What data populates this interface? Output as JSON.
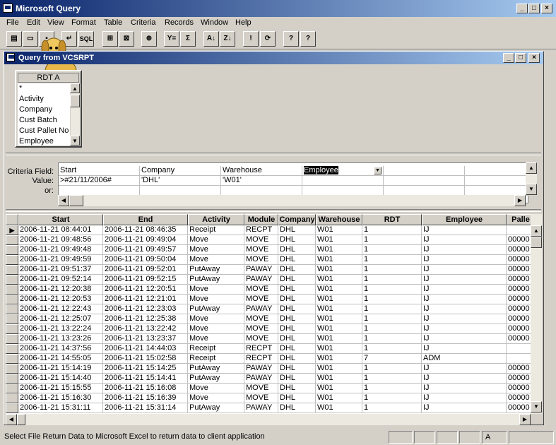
{
  "app": {
    "title": "Microsoft Query"
  },
  "menu": [
    "File",
    "Edit",
    "View",
    "Format",
    "Table",
    "Criteria",
    "Records",
    "Window",
    "Help"
  ],
  "toolbar": {
    "sql_label": "SQL",
    "sum_label": "Σ",
    "exclaim_label": "!"
  },
  "query_window": {
    "title": "Query from VCSRPT"
  },
  "table_box": {
    "name": "RDT A",
    "fields": [
      "*",
      "Activity",
      "Company",
      "Cust Batch",
      "Cust Pallet No",
      "Employee"
    ]
  },
  "criteria": {
    "labels": [
      "Criteria Field:",
      "Value:",
      "or:"
    ],
    "fields": [
      "Start",
      "Company",
      "Warehouse",
      "Employee",
      "",
      ""
    ],
    "values": [
      ">#21/11/2006#",
      "'DHL'",
      "'W01'",
      "",
      "",
      ""
    ]
  },
  "data_grid": {
    "columns": [
      "Start",
      "End",
      "Activity",
      "Module",
      "Company",
      "Warehouse",
      "RDT",
      "Employee",
      "Palle"
    ],
    "rows": [
      [
        "2006-11-21 08:44:01",
        "2006-11-21 08:46:35",
        "Receipt",
        "RECPT",
        "DHL",
        "W01",
        "1",
        "IJ",
        ""
      ],
      [
        "2006-11-21 09:48:56",
        "2006-11-21 09:49:04",
        "Move",
        "MOVE",
        "DHL",
        "W01",
        "1",
        "IJ",
        "00000"
      ],
      [
        "2006-11-21 09:49:48",
        "2006-11-21 09:49:57",
        "Move",
        "MOVE",
        "DHL",
        "W01",
        "1",
        "IJ",
        "00000"
      ],
      [
        "2006-11-21 09:49:59",
        "2006-11-21 09:50:04",
        "Move",
        "MOVE",
        "DHL",
        "W01",
        "1",
        "IJ",
        "00000"
      ],
      [
        "2006-11-21 09:51:37",
        "2006-11-21 09:52:01",
        "PutAway",
        "PAWAY",
        "DHL",
        "W01",
        "1",
        "IJ",
        "00000"
      ],
      [
        "2006-11-21 09:52:14",
        "2006-11-21 09:52:15",
        "PutAway",
        "PAWAY",
        "DHL",
        "W01",
        "1",
        "IJ",
        "00000"
      ],
      [
        "2006-11-21 12:20:38",
        "2006-11-21 12:20:51",
        "Move",
        "MOVE",
        "DHL",
        "W01",
        "1",
        "IJ",
        "00000"
      ],
      [
        "2006-11-21 12:20:53",
        "2006-11-21 12:21:01",
        "Move",
        "MOVE",
        "DHL",
        "W01",
        "1",
        "IJ",
        "00000"
      ],
      [
        "2006-11-21 12:22:43",
        "2006-11-21 12:23:03",
        "PutAway",
        "PAWAY",
        "DHL",
        "W01",
        "1",
        "IJ",
        "00000"
      ],
      [
        "2006-11-21 12:25:07",
        "2006-11-21 12:25:38",
        "Move",
        "MOVE",
        "DHL",
        "W01",
        "1",
        "IJ",
        "00000"
      ],
      [
        "2006-11-21 13:22:24",
        "2006-11-21 13:22:42",
        "Move",
        "MOVE",
        "DHL",
        "W01",
        "1",
        "IJ",
        "00000"
      ],
      [
        "2006-11-21 13:23:26",
        "2006-11-21 13:23:37",
        "Move",
        "MOVE",
        "DHL",
        "W01",
        "1",
        "IJ",
        "00000"
      ],
      [
        "2006-11-21 14:37:56",
        "2006-11-21 14:44:03",
        "Receipt",
        "RECPT",
        "DHL",
        "W01",
        "1",
        "IJ",
        ""
      ],
      [
        "2006-11-21 14:55:05",
        "2006-11-21 15:02:58",
        "Receipt",
        "RECPT",
        "DHL",
        "W01",
        "7",
        "ADM",
        ""
      ],
      [
        "2006-11-21 15:14:19",
        "2006-11-21 15:14:25",
        "PutAway",
        "PAWAY",
        "DHL",
        "W01",
        "1",
        "IJ",
        "00000"
      ],
      [
        "2006-11-21 15:14:40",
        "2006-11-21 15:14:41",
        "PutAway",
        "PAWAY",
        "DHL",
        "W01",
        "1",
        "IJ",
        "00000"
      ],
      [
        "2006-11-21 15:15:55",
        "2006-11-21 15:16:08",
        "Move",
        "MOVE",
        "DHL",
        "W01",
        "1",
        "IJ",
        "00000"
      ],
      [
        "2006-11-21 15:16:30",
        "2006-11-21 15:16:39",
        "Move",
        "MOVE",
        "DHL",
        "W01",
        "1",
        "IJ",
        "00000"
      ],
      [
        "2006-11-21 15:31:11",
        "2006-11-21 15:31:14",
        "PutAway",
        "PAWAY",
        "DHL",
        "W01",
        "1",
        "IJ",
        "00000"
      ]
    ]
  },
  "status": {
    "message": "Select File Return Data to Microsoft Excel to return data to client application",
    "indicator": "A"
  }
}
